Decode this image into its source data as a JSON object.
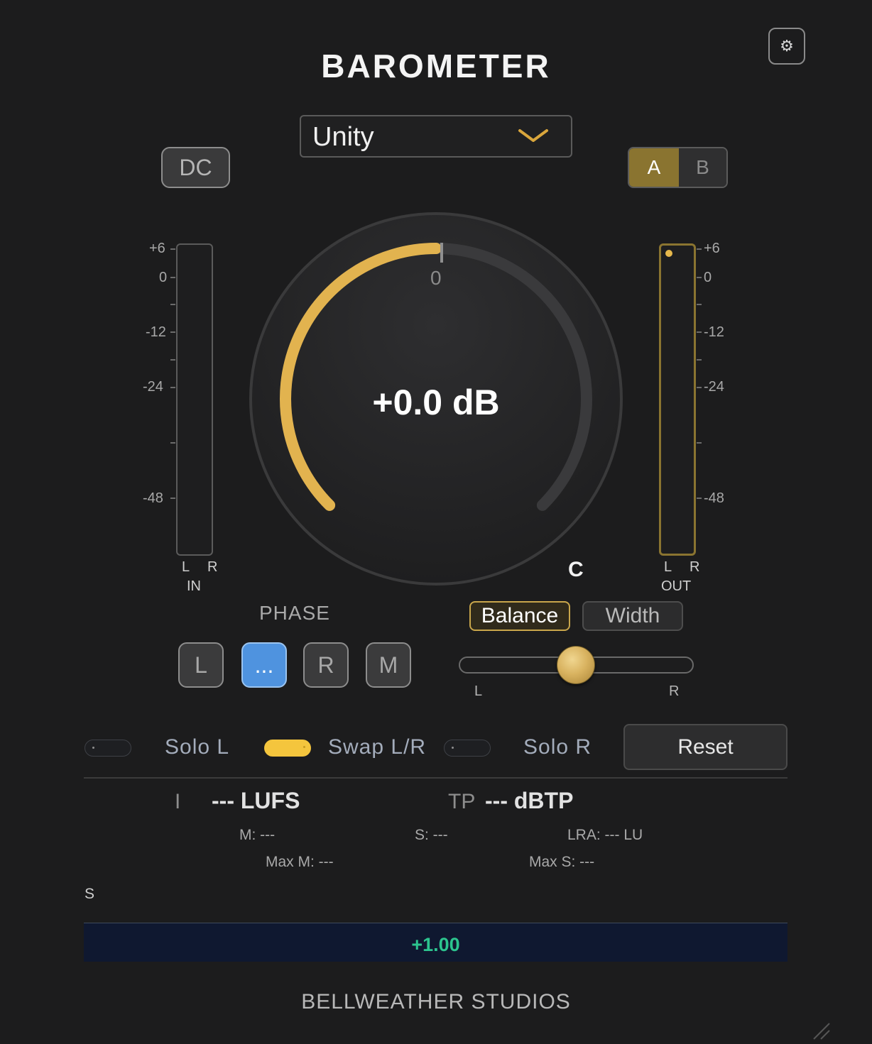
{
  "app": {
    "title": "BAROMETER",
    "footer": "BELLWEATHER STUDIOS"
  },
  "header": {
    "settings_icon": "gear-icon"
  },
  "preset": {
    "selected": "Unity",
    "chevron_icon": "chevron-down-icon"
  },
  "dc": {
    "label": "DC"
  },
  "ab": {
    "a_label": "A",
    "b_label": "B",
    "active": "A"
  },
  "meters": {
    "in": {
      "scale": [
        "+6",
        "0",
        "-12",
        "-24",
        "-48"
      ],
      "channels": "L R",
      "label": "IN"
    },
    "out": {
      "scale": [
        "+6",
        "0",
        "-12",
        "-24",
        "-48"
      ],
      "channels": "L R",
      "label": "OUT"
    }
  },
  "knob": {
    "value": "+0.0 dB",
    "zero_label": "0",
    "fill_fraction": 0.5
  },
  "pan": {
    "position_label": "C",
    "left": "L",
    "right": "R",
    "balance_fraction": 0.5
  },
  "phase": {
    "label": "PHASE",
    "buttons": [
      {
        "label": "L",
        "active": false
      },
      {
        "label": "...",
        "active": true
      },
      {
        "label": "R",
        "active": false
      },
      {
        "label": "M",
        "active": false
      }
    ]
  },
  "stereo_mode": {
    "balance": "Balance",
    "width": "Width",
    "active": "Balance"
  },
  "toggles": [
    {
      "label": "Solo L",
      "on": false
    },
    {
      "label": "Swap L/R",
      "on": true
    },
    {
      "label": "Solo R",
      "on": false
    }
  ],
  "reset": {
    "label": "Reset"
  },
  "loudness": {
    "i_label": "I",
    "lufs": "--- LUFS",
    "tp_label": "TP",
    "dbtp": "--- dBTP",
    "m": "M: ---",
    "s": "S: ---",
    "lra": "LRA: --- LU",
    "max_m": "Max M: ---",
    "max_s": "Max S: ---"
  },
  "graph": {
    "s_label": "S",
    "gain": "+1.00"
  },
  "colors": {
    "accent": "#e6b84c",
    "active_blue": "#4f93df",
    "gain_green": "#2cc48e"
  }
}
